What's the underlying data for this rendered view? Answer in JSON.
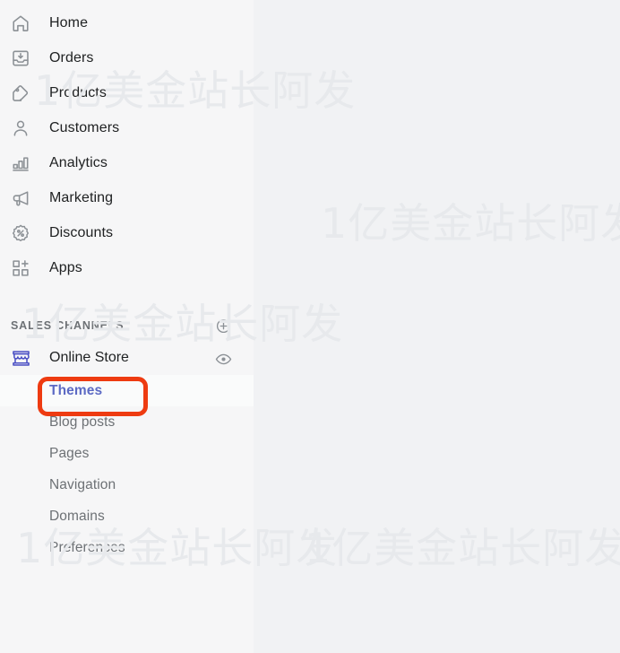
{
  "theme": {
    "page_background": "#f1f2f4",
    "sidebar_background": "#f6f6f7",
    "primary_text": "#202223",
    "secondary_text": "#6d7175",
    "icon_color": "#8c9196",
    "accent_indigo": "#5c6ac4",
    "channel_icon_color": "#4a4fc4",
    "annotation_red": "#ee3b11",
    "watermark_color": "#e7e9ec"
  },
  "sidebar": {
    "primary_nav": [
      {
        "label": "Home",
        "icon": "home-icon"
      },
      {
        "label": "Orders",
        "icon": "orders-icon"
      },
      {
        "label": "Products",
        "icon": "products-tag-icon"
      },
      {
        "label": "Customers",
        "icon": "customers-person-icon"
      },
      {
        "label": "Analytics",
        "icon": "analytics-bar-chart-icon"
      },
      {
        "label": "Marketing",
        "icon": "marketing-megaphone-icon"
      },
      {
        "label": "Discounts",
        "icon": "discounts-badge-icon"
      },
      {
        "label": "Apps",
        "icon": "apps-grid-plus-icon"
      }
    ],
    "sales_channels": {
      "section_label": "SALES CHANNELS",
      "add_button_icon": "circle-plus-icon",
      "channel": {
        "label": "Online Store",
        "icon": "online-store-icon",
        "preview_button_icon": "eye-icon"
      },
      "sub_items": [
        {
          "label": "Themes",
          "active": true
        },
        {
          "label": "Blog posts",
          "active": false
        },
        {
          "label": "Pages",
          "active": false
        },
        {
          "label": "Navigation",
          "active": false
        },
        {
          "label": "Domains",
          "active": false
        },
        {
          "label": "Preferences",
          "active": false
        }
      ]
    }
  },
  "annotation": {
    "target_label": "Themes",
    "shape": "rounded-rectangle-outline",
    "color": "#ee3b11"
  },
  "watermarks": {
    "text": "1亿美金站长阿发",
    "instances": [
      {
        "id": "wm-1"
      },
      {
        "id": "wm-2"
      },
      {
        "id": "wm-3"
      },
      {
        "id": "wm-4"
      },
      {
        "id": "wm-5"
      }
    ]
  }
}
